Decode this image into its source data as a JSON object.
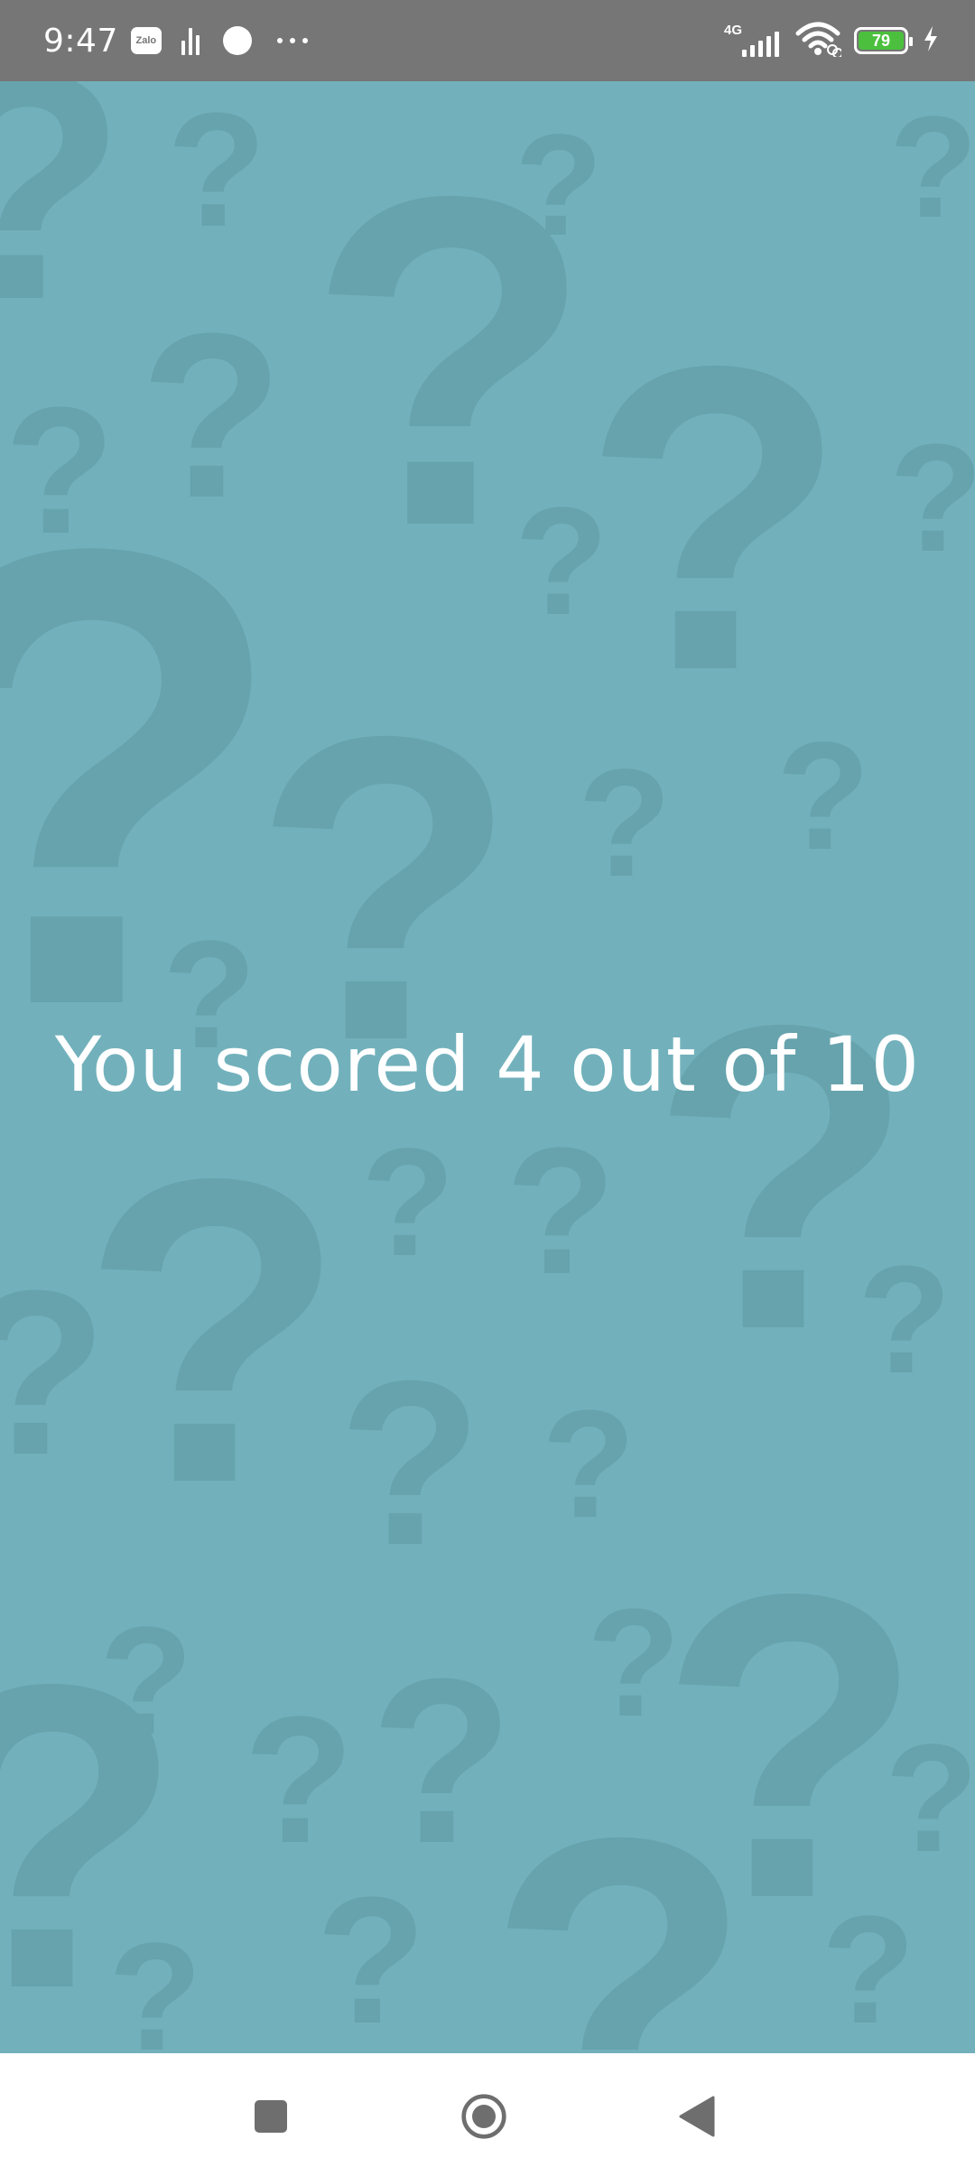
{
  "status_bar": {
    "time": "9:47",
    "notification_app": "Zalo",
    "network": "4G",
    "battery_level": "79",
    "battery_color": "#4cc03e",
    "icons": [
      "zalo-icon",
      "equalizer-icon",
      "record-dot-icon",
      "more-dots-icon",
      "signal-icon",
      "wifi-icon",
      "battery-icon",
      "charging-bolt-icon"
    ]
  },
  "main": {
    "background_color": "#72b1bc",
    "pattern_icon": "question-mark-icon",
    "score_text": "You scored 4 out of 10"
  },
  "nav_bar": {
    "buttons": [
      "recents-button",
      "home-button",
      "back-button"
    ]
  }
}
